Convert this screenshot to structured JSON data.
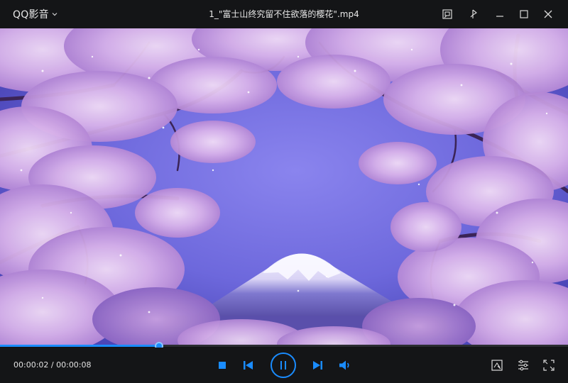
{
  "titlebar": {
    "app_name": "QQ影音",
    "file_title": "1_\"富士山终究留不住欲落的樱花\".mp4"
  },
  "player": {
    "current_time": "00:00:02",
    "separator": " / ",
    "total_time": "00:00:08",
    "progress_fraction": 0.28
  },
  "colors": {
    "accent": "#1a8cff",
    "background": "#141517",
    "text": "#e6e6e6"
  },
  "icons": {
    "titlebar": [
      "chevron-down-icon",
      "mini-mode-icon",
      "pin-on-top-icon",
      "minimize-icon",
      "maximize-icon",
      "close-icon"
    ],
    "controls": [
      "stop-icon",
      "previous-icon",
      "pause-icon",
      "next-icon",
      "volume-icon",
      "screenshot-icon",
      "settings-icon",
      "fullscreen-icon"
    ]
  }
}
